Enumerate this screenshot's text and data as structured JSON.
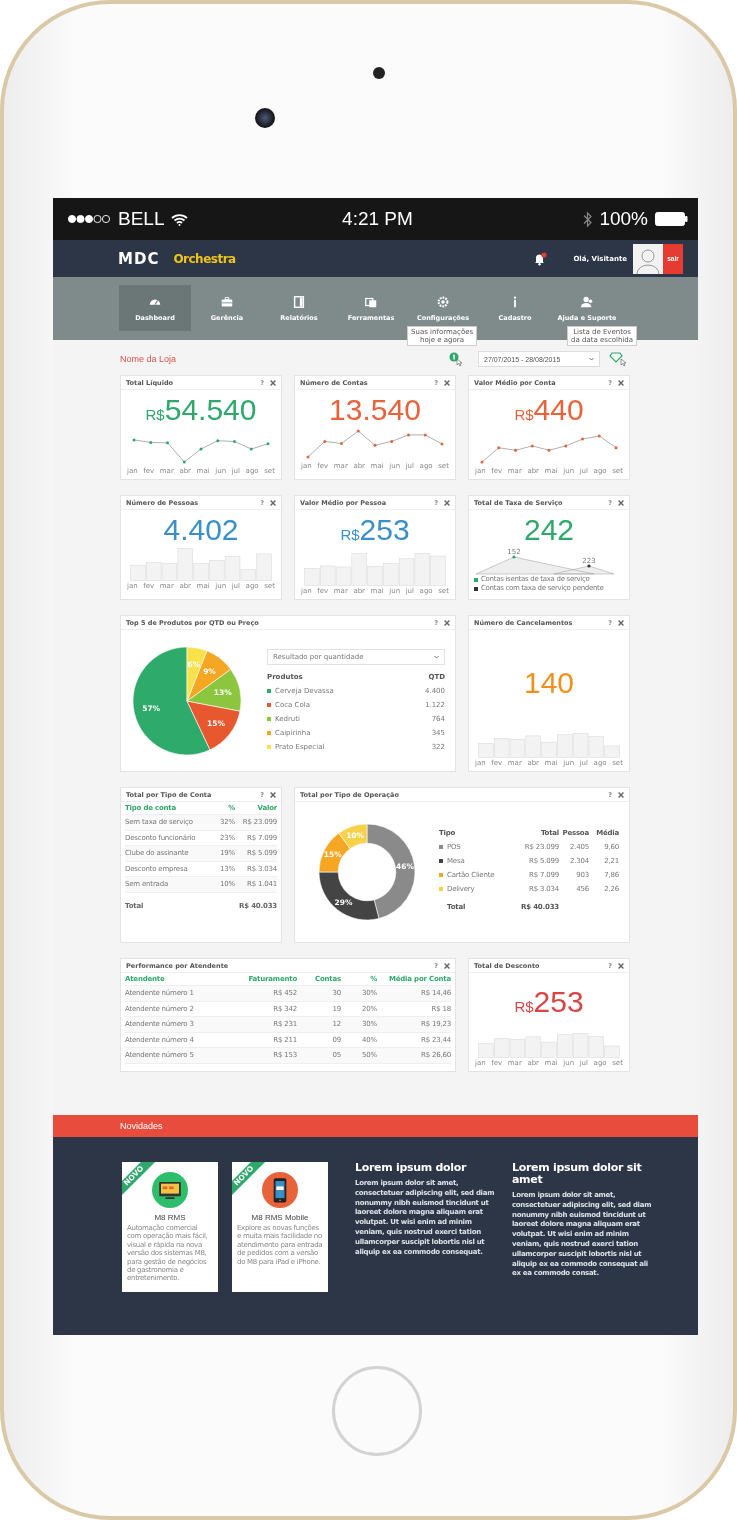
{
  "status_bar": {
    "carrier": "BELL",
    "time": "4:21 PM",
    "battery": "100%"
  },
  "header": {
    "logo": "MDC",
    "product": "Orchestra",
    "greeting": "Olá, Visitante",
    "logout": "sair"
  },
  "nav": [
    {
      "label": "Dashboard",
      "selected": true
    },
    {
      "label": "Gerência",
      "selected": false
    },
    {
      "label": "Relatórios",
      "selected": false
    },
    {
      "label": "Ferramentas",
      "selected": false
    },
    {
      "label": "Configurações",
      "selected": false
    },
    {
      "label": "Cadastro",
      "selected": false
    },
    {
      "label": "Ajuda e Suporte",
      "selected": false
    }
  ],
  "tooltips": [
    {
      "title": "Suas informações",
      "subtitle": "hoje e agora"
    },
    {
      "title": "Lista de Eventos",
      "subtitle": "da data escolhida"
    }
  ],
  "toolbar": {
    "store": "Nome da Loja",
    "date_range": "27/07/2015 - 28/08/2015"
  },
  "widgets": [
    {
      "kind": "line_kpi",
      "title": "Total Líquido",
      "help": "?",
      "prefix": "R$",
      "value": "54.540",
      "color": "#2ea86b",
      "months": [
        "jan",
        "fev",
        "mar",
        "abr",
        "mai",
        "jun",
        "jul",
        "ago",
        "set"
      ]
    },
    {
      "kind": "line_kpi",
      "title": "Número de Contas",
      "help": "?",
      "value": "13.540",
      "color": "#e8623a",
      "months": [
        "jan",
        "fev",
        "mar",
        "abr",
        "mai",
        "jun",
        "jul",
        "ago",
        "set"
      ]
    },
    {
      "kind": "line_kpi",
      "title": "Valor Médio por Conta",
      "help": "?",
      "prefix": "R$",
      "value": "440",
      "color": "#e8623a",
      "months": [
        "jan",
        "fev",
        "mar",
        "abr",
        "mai",
        "jun",
        "jul",
        "ago",
        "set"
      ]
    },
    {
      "kind": "bar_kpi",
      "title": "Número de Pessoas",
      "help": "?",
      "value": "4.402",
      "color": "#3a8fc8",
      "months": [
        "jan",
        "fev",
        "mar",
        "abr",
        "mai",
        "jun",
        "jul",
        "ago",
        "set"
      ]
    },
    {
      "kind": "bar_kpi",
      "title": "Valor Médio por Pessoa",
      "help": "?",
      "prefix": "R$",
      "value": "253",
      "color": "#3a8fc8",
      "months": [
        "jan",
        "fev",
        "mar",
        "abr",
        "mai",
        "jun",
        "jul",
        "ago",
        "set"
      ]
    },
    {
      "kind": "area_kpi",
      "title": "Total de Taxa de Serviço",
      "help": "?",
      "value": "242",
      "color": "#2ea86b",
      "peaks": [
        "152",
        "223"
      ],
      "legend": [
        {
          "label": "Contas isentas de taxa de serviço",
          "color": "#2ea86b"
        },
        {
          "label": "Contas com taxa de serviço pendente",
          "color": "#333333"
        }
      ]
    },
    {
      "kind": "pie",
      "title": "Top 5 de Produtos por QTD ou Preço",
      "help": "?",
      "select": "Resultado por quantidade",
      "columns": [
        "Produtos",
        "QTD"
      ],
      "products": [
        {
          "qty": "4.400",
          "color": "#2eaa6a"
        },
        {
          "qty": "1.122",
          "color": "#e8582e"
        },
        {
          "qty": "764",
          "color": "#8cc63f"
        },
        {
          "qty": "345",
          "color": "#f5a623"
        },
        {
          "qty": "322",
          "color": "#f8e14a"
        }
      ],
      "chart_data": {
        "type": "pie",
        "categories": [
          "Cerveja Devassa",
          "Coca Cola",
          "Kedruti",
          "Caipirinha",
          "Prato Especial"
        ],
        "values": [
          57,
          15,
          13,
          9,
          6
        ],
        "value_labels": [
          "57%",
          "15%",
          "13%",
          "9%",
          "6%"
        ]
      }
    },
    {
      "kind": "big_kpi",
      "title": "Número de Cancelamentos",
      "help": "?",
      "value": "140",
      "color": "#f0901e",
      "months": [
        "jan",
        "fev",
        "mar",
        "abr",
        "mai",
        "jun",
        "jul",
        "ago",
        "set"
      ]
    },
    {
      "kind": "table",
      "title": "Total por Tipo de Conta",
      "help": "?",
      "columns": [
        "Tipo de conta",
        "%",
        "Valor"
      ],
      "rows": [
        [
          "Sem taxa de serviço",
          "32%",
          "R$ 23.099"
        ],
        [
          "Desconto funcionário",
          "23%",
          "R$ 7.099"
        ],
        [
          "Clube do assinante",
          "19%",
          "R$ 5.099"
        ],
        [
          "Desconto empresa",
          "13%",
          "R$ 3.034"
        ],
        [
          "Sem entrada",
          "10%",
          "R$ 1.041"
        ]
      ],
      "total": {
        "label": "Total",
        "value": "R$ 40.033"
      }
    },
    {
      "kind": "donut",
      "title": "Total por Tipo de Operação",
      "help": "?",
      "columns": [
        "Tipo",
        "Total",
        "Pessoa",
        "Média"
      ],
      "rows": [
        {
          "total": "R$ 23.099",
          "people": "2.405",
          "avg": "9,60",
          "color": "#8a8a8a"
        },
        {
          "total": "R$ 5.099",
          "people": "2.304",
          "avg": "2,21",
          "color": "#444444"
        },
        {
          "total": "R$ 7.099",
          "people": "903",
          "avg": "7,86",
          "color": "#f5a623"
        },
        {
          "total": "R$ 3.034",
          "people": "456",
          "avg": "2,26",
          "color": "#f8d14a"
        }
      ],
      "total": {
        "label": "Total",
        "value": "R$ 40.033"
      },
      "chart_data": {
        "type": "donut",
        "categories": [
          "POS",
          "Mesa",
          "Cartão Cliente",
          "Delivery"
        ],
        "values": [
          46,
          29,
          15,
          10
        ],
        "value_labels": [
          "46%",
          "29%",
          "15%",
          "10%"
        ]
      }
    },
    {
      "kind": "table",
      "title": "Performance por Atendente",
      "help": "?",
      "columns": [
        "Atendente",
        "Faturamento",
        "Contas",
        "%",
        "Média por Conta"
      ],
      "rows": [
        [
          "Atendente número 1",
          "R$ 452",
          "30",
          "30%",
          "R$ 14,46"
        ],
        [
          "Atendente número 2",
          "R$ 342",
          "19",
          "20%",
          "R$ 18"
        ],
        [
          "Atendente número 3",
          "R$ 231",
          "12",
          "30%",
          "R$ 19,23"
        ],
        [
          "Atendente número 4",
          "R$ 211",
          "09",
          "40%",
          "R$ 23,44"
        ],
        [
          "Atendente número 5",
          "R$ 153",
          "05",
          "50%",
          "R$ 26,60"
        ]
      ]
    },
    {
      "kind": "big_kpi",
      "title": "Total de Desconto",
      "help": "?",
      "prefix": "R$",
      "value": "253",
      "color": "#d94545",
      "months": [
        "jan",
        "fev",
        "mar",
        "abr",
        "mai",
        "jun",
        "jul",
        "ago",
        "set"
      ]
    }
  ],
  "news": {
    "title": "Novidades",
    "cards": [
      {
        "badge": "NOVO",
        "title": "M8 RMS",
        "text": "Automação comercial com operação mais fácil, visual e rápida na nova versão dos sistemas M8, para gestão de negócios de gastronomia e entretenimento.",
        "color": "#2ebd6b"
      },
      {
        "badge": "NOVO",
        "title": "M8 RMS Mobile",
        "text": "Explore as novas funções e muita mais facilidade no atendimento para entrada de pedidos com a versão do M8 para iPad e iPhone.",
        "color": "#e8623a"
      }
    ],
    "articles": [
      {
        "title": "Lorem ipsum dolor",
        "text": "Lorem ipsum dolor sit amet, consectetuer adipiscing elit, sed diam nonummy nibh euismod tincidunt ut laoreet dolore magna aliquam erat volutpat. Ut wisi enim ad minim veniam, quis nostrud exerci tation ullamcorper suscipit lobortis nisl ut aliquip ex ea commodo consequat."
      },
      {
        "title": "Lorem ipsum dolor sit amet",
        "text": "Lorem ipsum dolor sit amet, consectetuer adipiscing elit, sed diam nonummy nibh euismod tincidunt ut laoreet dolore magna aliquam erat volutpat. Ut wisi enim ad minim veniam, quis nostrud exerci tation ullamcorper suscipit lobortis nisl ut aliquip ex ea commodo consequat ali ex ea commodo consat."
      }
    ]
  }
}
